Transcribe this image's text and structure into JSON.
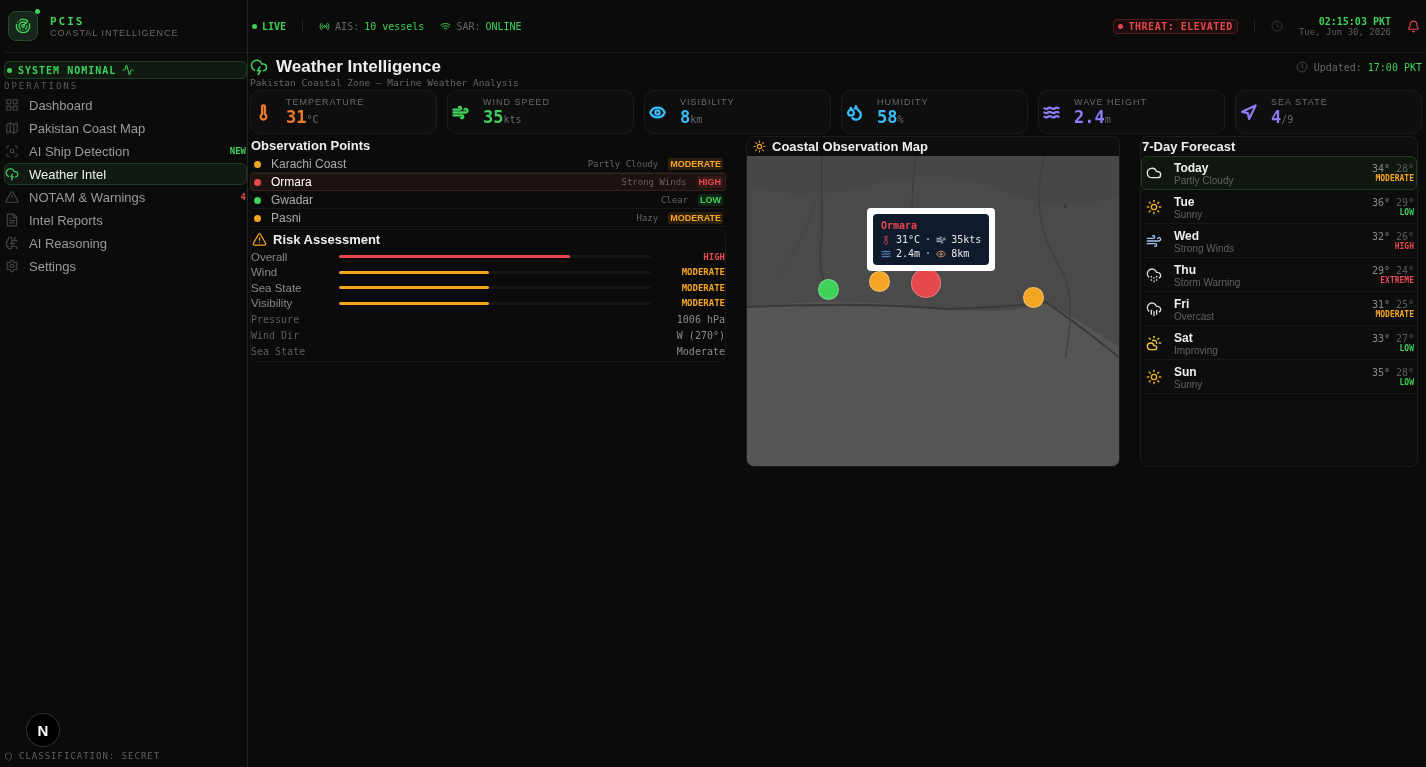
{
  "brand": {
    "name": "PCIS",
    "subtitle": "COASTAL INTELLIGENCE"
  },
  "system_status": "SYSTEM NOMINAL",
  "nav_section": "OPERATIONS",
  "nav": [
    {
      "label": "Dashboard",
      "selected": false
    },
    {
      "label": "Pakistan Coast Map",
      "selected": false
    },
    {
      "label": "AI Ship Detection",
      "selected": false,
      "badge": {
        "text": "NEW",
        "color": "#3fd15a"
      }
    },
    {
      "label": "Weather Intel",
      "selected": true
    },
    {
      "label": "NOTAM & Warnings",
      "selected": false,
      "badge": {
        "text": "4",
        "color": "#e5484d"
      }
    },
    {
      "label": "Intel Reports",
      "selected": false
    },
    {
      "label": "AI Reasoning",
      "selected": false
    },
    {
      "label": "Settings",
      "selected": false
    }
  ],
  "footer": "CLASSIFICATION: SECRET",
  "dev_badge": "N",
  "topbar": {
    "live": "LIVE",
    "ais_label": "AIS:",
    "ais_value": "10 vessels",
    "sar_label": "SAR:",
    "sar_value": "ONLINE",
    "threat": "THREAT: ELEVATED",
    "time": "02:15:03 PKT",
    "date": "Tue, Jun 30, 2026"
  },
  "page": {
    "title": "Weather Intelligence",
    "subtitle": "Pakistan Coastal Zone — Marine Weather Analysis",
    "updated_label": "Updated:",
    "updated_value": "17:00 PKT"
  },
  "stats": [
    {
      "label": "TEMPERATURE",
      "value": "31",
      "unit": "°C",
      "color": "#f07a2a"
    },
    {
      "label": "WIND SPEED",
      "value": "35",
      "unit": "kts",
      "color": "#3fd15a"
    },
    {
      "label": "VISIBILITY",
      "value": "8",
      "unit": "km",
      "color": "#38bdf8"
    },
    {
      "label": "HUMIDITY",
      "value": "58",
      "unit": "%",
      "color": "#38bdf8"
    },
    {
      "label": "WAVE HEIGHT",
      "value": "2.4",
      "unit": "m",
      "color": "#8b7cf6"
    },
    {
      "label": "SEA STATE",
      "value": "4",
      "unit": "/9",
      "color": "#8b7cf6"
    }
  ],
  "observation_points": {
    "title": "Observation Points",
    "items": [
      {
        "name": "Karachi Coast",
        "condition": "Partly Cloudy",
        "risk": "MODERATE",
        "color": "#f5a524",
        "selected": false
      },
      {
        "name": "Ormara",
        "condition": "Strong Winds",
        "risk": "HIGH",
        "color": "#e5484d",
        "selected": true
      },
      {
        "name": "Gwadar",
        "condition": "Clear",
        "risk": "LOW",
        "color": "#3fd15a",
        "selected": false
      },
      {
        "name": "Pasni",
        "condition": "Hazy",
        "risk": "MODERATE",
        "color": "#f5a524",
        "selected": false
      }
    ]
  },
  "risk_assessment": {
    "title": "Risk Assessment",
    "bars": [
      {
        "label": "Overall",
        "level": 0.74,
        "value": "HIGH",
        "color": "#e5484d"
      },
      {
        "label": "Wind",
        "level": 0.48,
        "value": "MODERATE",
        "color": "#f5a524"
      },
      {
        "label": "Sea State",
        "level": 0.48,
        "value": "MODERATE",
        "color": "#f5a524"
      },
      {
        "label": "Visibility",
        "level": 0.48,
        "value": "MODERATE",
        "color": "#f5a524"
      }
    ],
    "details": [
      {
        "label": "Pressure",
        "value": "1006 hPa"
      },
      {
        "label": "Wind Dir",
        "value": "W (270°)"
      },
      {
        "label": "Sea State",
        "value": "Moderate"
      }
    ]
  },
  "map": {
    "title": "Coastal Observation Map",
    "kind": "picture",
    "markers": [
      {
        "color": "#3fd15a",
        "selected": false
      },
      {
        "color": "#f5a524",
        "selected": false
      },
      {
        "color": "#e5484d",
        "selected": true
      },
      {
        "color": "#f5a524",
        "selected": false
      }
    ],
    "tooltip": {
      "name": "Ormara",
      "separator": "·",
      "temperature": "31°C",
      "wind": "35kts",
      "wave": "2.4m",
      "visibility": "8km"
    }
  },
  "forecast": {
    "title": "7-Day Forecast",
    "days": [
      {
        "day": "Today",
        "condition": "Partly Cloudy",
        "high": "34°",
        "low": "28°",
        "risk": "MODERATE",
        "color": "#f5a524",
        "kind": "cloudy",
        "selected": true
      },
      {
        "day": "Tue",
        "condition": "Sunny",
        "high": "36°",
        "low": "29°",
        "risk": "LOW",
        "color": "#3fd15a",
        "kind": "sunny",
        "selected": false
      },
      {
        "day": "Wed",
        "condition": "Strong Winds",
        "high": "32°",
        "low": "26°",
        "risk": "HIGH",
        "color": "#e5484d",
        "kind": "windy",
        "selected": false
      },
      {
        "day": "Thu",
        "condition": "Storm Warning",
        "high": "29°",
        "low": "24°",
        "risk": "EXTREME",
        "color": "#e5484d",
        "kind": "storm",
        "selected": false
      },
      {
        "day": "Fri",
        "condition": "Overcast",
        "high": "31°",
        "low": "25°",
        "risk": "MODERATE",
        "color": "#f5a524",
        "kind": "rain",
        "selected": false
      },
      {
        "day": "Sat",
        "condition": "Improving",
        "high": "33°",
        "low": "27°",
        "risk": "LOW",
        "color": "#3fd15a",
        "kind": "partly",
        "selected": false
      },
      {
        "day": "Sun",
        "condition": "Sunny",
        "high": "35°",
        "low": "28°",
        "risk": "LOW",
        "color": "#3fd15a",
        "kind": "sunny",
        "selected": false
      }
    ]
  }
}
